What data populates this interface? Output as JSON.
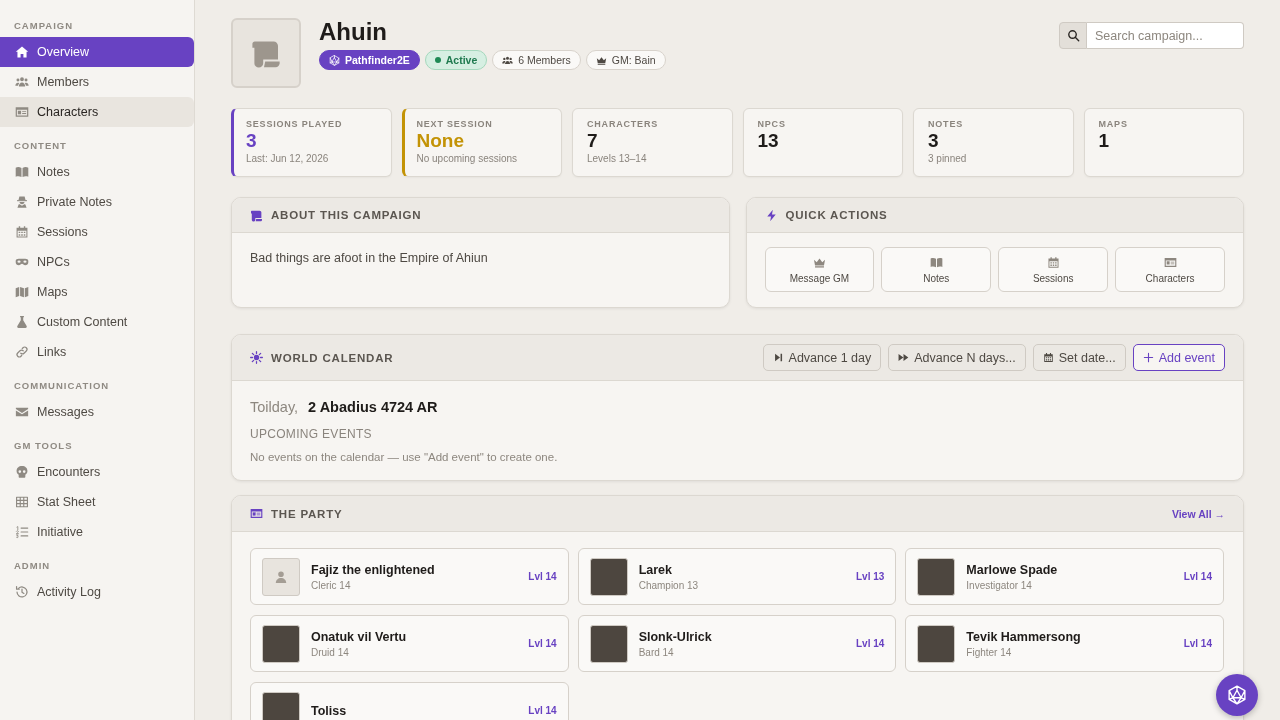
{
  "sidebar": {
    "sections": [
      {
        "title": "CAMPAIGN",
        "items": [
          {
            "label": "Overview",
            "selected": true,
            "hovered": false
          },
          {
            "label": "Members",
            "selected": false,
            "hovered": false
          },
          {
            "label": "Characters",
            "selected": false,
            "hovered": true
          }
        ]
      },
      {
        "title": "CONTENT",
        "items": [
          {
            "label": "Notes",
            "selected": false,
            "hovered": false
          },
          {
            "label": "Private Notes",
            "selected": false,
            "hovered": false
          },
          {
            "label": "Sessions",
            "selected": false,
            "hovered": false
          },
          {
            "label": "NPCs",
            "selected": false,
            "hovered": false
          },
          {
            "label": "Maps",
            "selected": false,
            "hovered": false
          },
          {
            "label": "Custom Content",
            "selected": false,
            "hovered": false
          },
          {
            "label": "Links",
            "selected": false,
            "hovered": false
          }
        ]
      },
      {
        "title": "COMMUNICATION",
        "items": [
          {
            "label": "Messages",
            "selected": false,
            "hovered": false
          }
        ]
      },
      {
        "title": "GM TOOLS",
        "items": [
          {
            "label": "Encounters",
            "selected": false,
            "hovered": false
          },
          {
            "label": "Stat Sheet",
            "selected": false,
            "hovered": false
          },
          {
            "label": "Initiative",
            "selected": false,
            "hovered": false
          }
        ]
      },
      {
        "title": "ADMIN",
        "items": [
          {
            "label": "Activity Log",
            "selected": false,
            "hovered": false
          }
        ]
      }
    ]
  },
  "header": {
    "title": "Ahuin",
    "badges": [
      {
        "kind": "system",
        "label": "Pathfinder2E"
      },
      {
        "kind": "status",
        "label": "Active"
      },
      {
        "kind": "members",
        "label": "6 Members"
      },
      {
        "kind": "gm",
        "label": "GM: Bain"
      }
    ],
    "search": {
      "placeholder": "Search campaign..."
    }
  },
  "stats": [
    {
      "label": "SESSIONS PLAYED",
      "value": "3",
      "detail": "Last: Jun 12, 2026",
      "color": "#6842c2"
    },
    {
      "label": "NEXT SESSION",
      "value": "None",
      "detail": "No upcoming sessions",
      "color": "#c39306"
    },
    {
      "label": "CHARACTERS",
      "value": "7",
      "detail": "Levels 13–14"
    },
    {
      "label": "NPCS",
      "value": "13"
    },
    {
      "label": "NOTES",
      "value": "3",
      "detail": "3 pinned"
    },
    {
      "label": "MAPS",
      "value": "1"
    }
  ],
  "about": {
    "title": "ABOUT THIS CAMPAIGN",
    "text": "Bad things are afoot in the Empire of Ahiun"
  },
  "quick_actions": {
    "title": "QUICK ACTIONS",
    "buttons": [
      "Message GM",
      "Notes",
      "Sessions",
      "Characters"
    ]
  },
  "calendar": {
    "title": "WORLD CALENDAR",
    "buttons": [
      {
        "kind": "step",
        "label": "Advance 1 day"
      },
      {
        "kind": "skip",
        "label": "Advance N days..."
      },
      {
        "kind": "date",
        "label": "Set date..."
      },
      {
        "kind": "add",
        "label": "Add event"
      }
    ],
    "weekday": "Toilday,",
    "date": "2 Abadius 4724 AR",
    "events_title": "UPCOMING EVENTS",
    "empty_text": "No events on the calendar — use \"Add event\" to create one."
  },
  "party": {
    "title": "THE PARTY",
    "link": "View All →",
    "characters": [
      {
        "name": "Fajiz the enlightened",
        "detail": "Cleric 14",
        "level": "Lvl 14",
        "has_portrait": false
      },
      {
        "name": "Larek",
        "detail": "Champion 13",
        "level": "Lvl 13",
        "has_portrait": true
      },
      {
        "name": "Marlowe Spade",
        "detail": "Investigator 14",
        "level": "Lvl 14",
        "has_portrait": true
      },
      {
        "name": "Onatuk vil Vertu",
        "detail": "Druid 14",
        "level": "Lvl 14",
        "has_portrait": true
      },
      {
        "name": "Slonk-Ulrick",
        "detail": "Bard 14",
        "level": "Lvl 14",
        "has_portrait": true
      },
      {
        "name": "Tevik Hammersong",
        "detail": "Fighter 14",
        "level": "Lvl 14",
        "has_portrait": true
      },
      {
        "name": "Toliss",
        "level": "Lvl 14",
        "has_portrait": true
      }
    ]
  }
}
